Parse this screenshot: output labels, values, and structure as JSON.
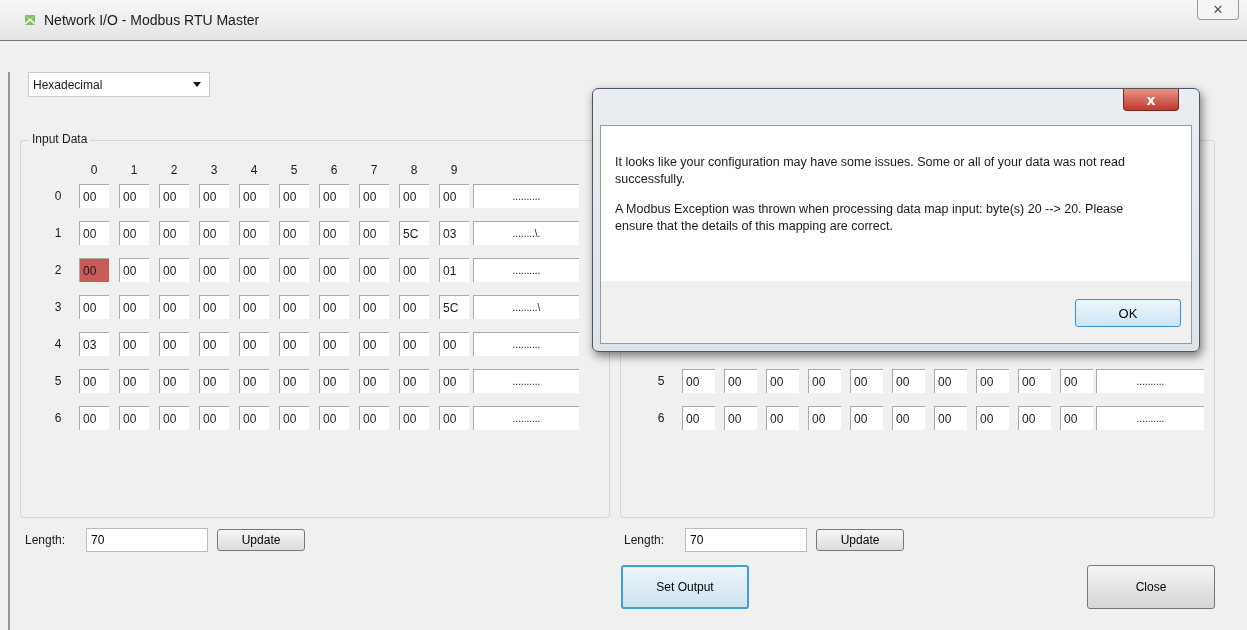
{
  "window": {
    "title": "Network I/O  -  Modbus RTU Master",
    "close": "✕"
  },
  "format": {
    "value": "Hexadecimal"
  },
  "input_data": {
    "title": "Input Data",
    "columns": [
      "0",
      "1",
      "2",
      "3",
      "4",
      "5",
      "6",
      "7",
      "8",
      "9"
    ],
    "rows": [
      {
        "label": "0",
        "cells": [
          {
            "value": "00",
            "error": false
          },
          {
            "value": "00",
            "error": false
          },
          {
            "value": "00",
            "error": false
          },
          {
            "value": "00",
            "error": false
          },
          {
            "value": "00",
            "error": false
          },
          {
            "value": "00",
            "error": false
          },
          {
            "value": "00",
            "error": false
          },
          {
            "value": "00",
            "error": false
          },
          {
            "value": "00",
            "error": false
          },
          {
            "value": "00",
            "error": false
          }
        ],
        "ascii": ".........."
      },
      {
        "label": "1",
        "cells": [
          {
            "value": "00",
            "error": false
          },
          {
            "value": "00",
            "error": false
          },
          {
            "value": "00",
            "error": false
          },
          {
            "value": "00",
            "error": false
          },
          {
            "value": "00",
            "error": false
          },
          {
            "value": "00",
            "error": false
          },
          {
            "value": "00",
            "error": false
          },
          {
            "value": "00",
            "error": false
          },
          {
            "value": "5C",
            "error": false
          },
          {
            "value": "03",
            "error": false
          }
        ],
        "ascii": "........\\."
      },
      {
        "label": "2",
        "cells": [
          {
            "value": "00",
            "error": true
          },
          {
            "value": "00",
            "error": false
          },
          {
            "value": "00",
            "error": false
          },
          {
            "value": "00",
            "error": false
          },
          {
            "value": "00",
            "error": false
          },
          {
            "value": "00",
            "error": false
          },
          {
            "value": "00",
            "error": false
          },
          {
            "value": "00",
            "error": false
          },
          {
            "value": "00",
            "error": false
          },
          {
            "value": "01",
            "error": false
          }
        ],
        "ascii": ".........."
      },
      {
        "label": "3",
        "cells": [
          {
            "value": "00",
            "error": false
          },
          {
            "value": "00",
            "error": false
          },
          {
            "value": "00",
            "error": false
          },
          {
            "value": "00",
            "error": false
          },
          {
            "value": "00",
            "error": false
          },
          {
            "value": "00",
            "error": false
          },
          {
            "value": "00",
            "error": false
          },
          {
            "value": "00",
            "error": false
          },
          {
            "value": "00",
            "error": false
          },
          {
            "value": "5C",
            "error": false
          }
        ],
        "ascii": ".........\\"
      },
      {
        "label": "4",
        "cells": [
          {
            "value": "03",
            "error": false
          },
          {
            "value": "00",
            "error": false
          },
          {
            "value": "00",
            "error": false
          },
          {
            "value": "00",
            "error": false
          },
          {
            "value": "00",
            "error": false
          },
          {
            "value": "00",
            "error": false
          },
          {
            "value": "00",
            "error": false
          },
          {
            "value": "00",
            "error": false
          },
          {
            "value": "00",
            "error": false
          },
          {
            "value": "00",
            "error": false
          }
        ],
        "ascii": ".........."
      },
      {
        "label": "5",
        "cells": [
          {
            "value": "00",
            "error": false
          },
          {
            "value": "00",
            "error": false
          },
          {
            "value": "00",
            "error": false
          },
          {
            "value": "00",
            "error": false
          },
          {
            "value": "00",
            "error": false
          },
          {
            "value": "00",
            "error": false
          },
          {
            "value": "00",
            "error": false
          },
          {
            "value": "00",
            "error": false
          },
          {
            "value": "00",
            "error": false
          },
          {
            "value": "00",
            "error": false
          }
        ],
        "ascii": ".........."
      },
      {
        "label": "6",
        "cells": [
          {
            "value": "00",
            "error": false
          },
          {
            "value": "00",
            "error": false
          },
          {
            "value": "00",
            "error": false
          },
          {
            "value": "00",
            "error": false
          },
          {
            "value": "00",
            "error": false
          },
          {
            "value": "00",
            "error": false
          },
          {
            "value": "00",
            "error": false
          },
          {
            "value": "00",
            "error": false
          },
          {
            "value": "00",
            "error": false
          },
          {
            "value": "00",
            "error": false
          }
        ],
        "ascii": ".........."
      }
    ],
    "length_label": "Length:",
    "length": "70",
    "update": "Update"
  },
  "output_data": {
    "rows": [
      {
        "label": "5",
        "cells": [
          {
            "value": "00",
            "error": false
          },
          {
            "value": "00",
            "error": false
          },
          {
            "value": "00",
            "error": false
          },
          {
            "value": "00",
            "error": false
          },
          {
            "value": "00",
            "error": false
          },
          {
            "value": "00",
            "error": false
          },
          {
            "value": "00",
            "error": false
          },
          {
            "value": "00",
            "error": false
          },
          {
            "value": "00",
            "error": false
          },
          {
            "value": "00",
            "error": false
          }
        ],
        "ascii": ".........."
      },
      {
        "label": "6",
        "cells": [
          {
            "value": "00",
            "error": false
          },
          {
            "value": "00",
            "error": false
          },
          {
            "value": "00",
            "error": false
          },
          {
            "value": "00",
            "error": false
          },
          {
            "value": "00",
            "error": false
          },
          {
            "value": "00",
            "error": false
          },
          {
            "value": "00",
            "error": false
          },
          {
            "value": "00",
            "error": false
          },
          {
            "value": "00",
            "error": false
          },
          {
            "value": "00",
            "error": false
          }
        ],
        "ascii": ".........."
      }
    ],
    "length_label": "Length:",
    "length": "70",
    "update": "Update"
  },
  "buttons": [
    {
      "label": "Set Output",
      "focused": true
    },
    {
      "label": "Close",
      "focused": false
    }
  ],
  "dialog": {
    "close": "x",
    "message": [
      "It looks like your configuration may have some issues. Some or all of your data was not read successfully.",
      "A Modbus Exception was thrown when processing data map input: byte(s) 20 --> 20. Please ensure that the details of this mapping are correct."
    ],
    "ok": "OK"
  }
}
